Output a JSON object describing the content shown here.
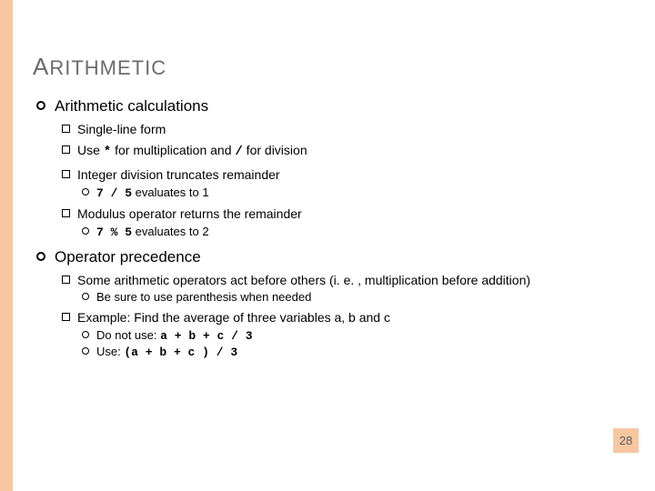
{
  "title_first": "A",
  "title_rest": "RITHMETIC",
  "sections": {
    "s1": {
      "text": "Arithmetic calculations",
      "a": "Single-line form",
      "b_pre": "Use ",
      "b_op1": "*",
      "b_mid": " for multiplication and ",
      "b_op2": "/",
      "b_post": " for division",
      "c": "Integer division truncates remainder",
      "c1_code": "7 / 5",
      "c1_rest": " evaluates to 1",
      "d": "Modulus operator returns the remainder",
      "d1_code": "7 % 5",
      "d1_rest": " evaluates to 2"
    },
    "s2": {
      "text": "Operator precedence",
      "a": "Some arithmetic operators act before others (i. e. , multiplication before addition)",
      "a1": "Be sure to use parenthesis when needed",
      "b": "Example: Find the average of three variables a, b and c",
      "b1_pre": "Do not use:  ",
      "b1_code": "a + b + c / 3",
      "b2_pre": "Use:  ",
      "b2_code": "(a + b + c ) / 3"
    }
  },
  "page_number": "28"
}
